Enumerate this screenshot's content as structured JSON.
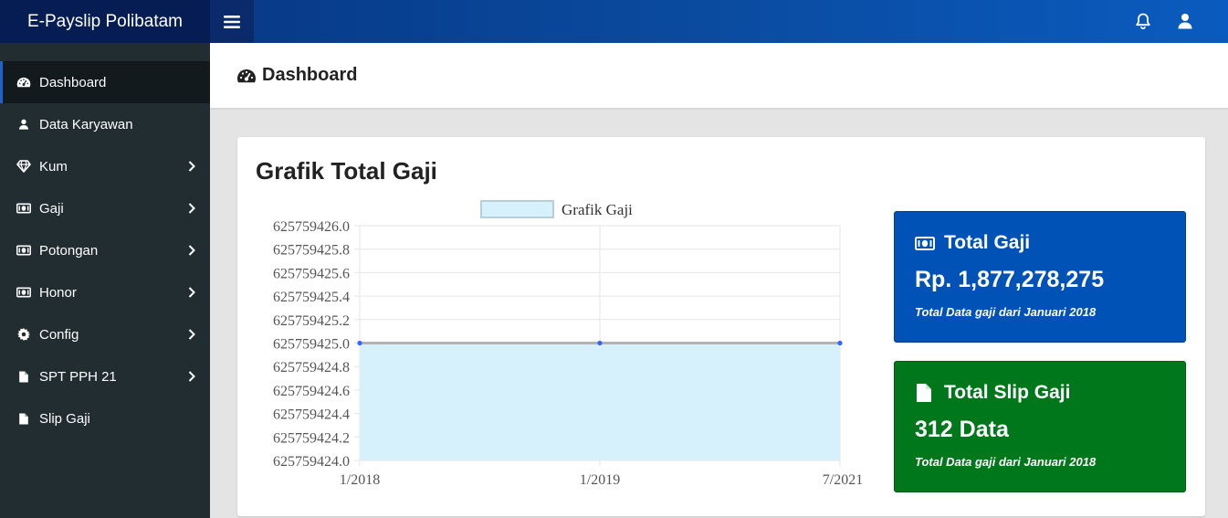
{
  "app": {
    "brand": "E-Payslip Polibatam",
    "icons": {
      "menu": "hamburger-icon",
      "notifications": "bell-icon",
      "user": "user-icon"
    }
  },
  "sidebar": {
    "items": [
      {
        "label": "Dashboard",
        "icon": "dashboard-icon",
        "active": true,
        "has_submenu": false
      },
      {
        "label": "Data Karyawan",
        "icon": "user-icon",
        "active": false,
        "has_submenu": false
      },
      {
        "label": "Kum",
        "icon": "diamond-icon",
        "active": false,
        "has_submenu": true
      },
      {
        "label": "Gaji",
        "icon": "money-icon",
        "active": false,
        "has_submenu": true
      },
      {
        "label": "Potongan",
        "icon": "money-icon",
        "active": false,
        "has_submenu": true
      },
      {
        "label": "Honor",
        "icon": "money-icon",
        "active": false,
        "has_submenu": true
      },
      {
        "label": "Config",
        "icon": "gear-icon",
        "active": false,
        "has_submenu": true
      },
      {
        "label": "SPT PPH 21",
        "icon": "file-icon",
        "active": false,
        "has_submenu": true
      },
      {
        "label": "Slip Gaji",
        "icon": "file-icon",
        "active": false,
        "has_submenu": false
      }
    ]
  },
  "header": {
    "title": "Dashboard",
    "icon": "dashboard-icon"
  },
  "main": {
    "box_title": "Grafik Total Gaji",
    "cards": [
      {
        "title": "Total Gaji",
        "value": "Rp. 1,877,278,275",
        "note": "Total Data gaji dari Januari 2018",
        "color": "#0052b6",
        "icon": "money-icon"
      },
      {
        "title": "Total Slip Gaji",
        "value": "312 Data",
        "note": "Total Data gaji dari Januari 2018",
        "color": "#00771a",
        "icon": "file-icon"
      }
    ]
  },
  "chart_data": {
    "type": "area",
    "title": "",
    "legend": "Grafik Gaji",
    "legend_position": "top",
    "grid": true,
    "categories": [
      "1/2018",
      "1/2019",
      "7/2021"
    ],
    "series": [
      {
        "name": "Grafik Gaji",
        "values": [
          625759425.0,
          625759425.0,
          625759425.0
        ]
      }
    ],
    "y_ticks": [
      "625759426.0",
      "625759425.8",
      "625759425.6",
      "625759425.4",
      "625759425.2",
      "625759425.0",
      "625759424.8",
      "625759424.6",
      "625759424.4",
      "625759424.2",
      "625759424.0"
    ],
    "ylim": [
      625759424.0,
      625759426.0
    ],
    "line_color": "#b3b3b3",
    "fill_color": "#d6f1fc",
    "point_color": "#3366ff"
  }
}
